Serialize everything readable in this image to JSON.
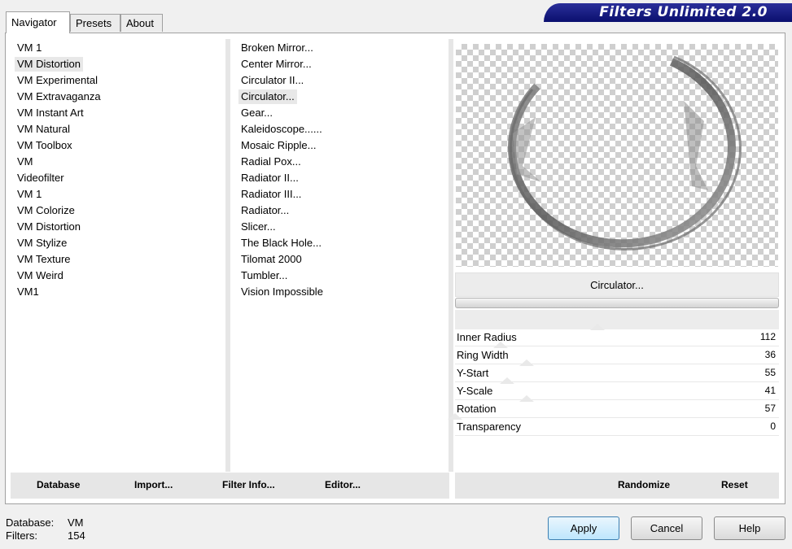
{
  "tabs": [
    {
      "label": "Navigator",
      "active": true
    },
    {
      "label": "Presets",
      "active": false
    },
    {
      "label": "About",
      "active": false
    }
  ],
  "banner": {
    "title": "Filters Unlimited 2.0"
  },
  "categories": [
    {
      "label": "VM 1",
      "selected": false
    },
    {
      "label": "VM Distortion",
      "selected": true
    },
    {
      "label": "VM Experimental",
      "selected": false
    },
    {
      "label": "VM Extravaganza",
      "selected": false
    },
    {
      "label": "VM Instant Art",
      "selected": false
    },
    {
      "label": "VM Natural",
      "selected": false
    },
    {
      "label": "VM Toolbox",
      "selected": false
    },
    {
      "label": "VM",
      "selected": false
    },
    {
      "label": "Videofilter",
      "selected": false
    },
    {
      "label": "VM 1",
      "selected": false
    },
    {
      "label": "VM Colorize",
      "selected": false
    },
    {
      "label": "VM Distortion",
      "selected": false
    },
    {
      "label": "VM Stylize",
      "selected": false
    },
    {
      "label": "VM Texture",
      "selected": false
    },
    {
      "label": "VM Weird",
      "selected": false
    },
    {
      "label": "VM1",
      "selected": false
    }
  ],
  "filters": [
    {
      "label": "Broken Mirror...",
      "selected": false
    },
    {
      "label": "Center Mirror...",
      "selected": false
    },
    {
      "label": "Circulator II...",
      "selected": false
    },
    {
      "label": "Circulator...",
      "selected": true
    },
    {
      "label": "Gear...",
      "selected": false
    },
    {
      "label": "Kaleidoscope......",
      "selected": false
    },
    {
      "label": "Mosaic Ripple...",
      "selected": false
    },
    {
      "label": "Radial Pox...",
      "selected": false
    },
    {
      "label": "Radiator II...",
      "selected": false
    },
    {
      "label": "Radiator III...",
      "selected": false
    },
    {
      "label": "Radiator...",
      "selected": false
    },
    {
      "label": "Slicer...",
      "selected": false
    },
    {
      "label": "The Black Hole...",
      "selected": false
    },
    {
      "label": "Tilomat 2000",
      "selected": false
    },
    {
      "label": "Tumbler...",
      "selected": false
    },
    {
      "label": "Vision Impossible",
      "selected": false
    }
  ],
  "preview": {
    "filter_name": "Circulator..."
  },
  "sliders": [
    {
      "label": "Inner Radius",
      "value": "112",
      "fraction": 0.44
    },
    {
      "label": "Ring Width",
      "value": "36",
      "fraction": 0.14
    },
    {
      "label": "Y-Start",
      "value": "55",
      "fraction": 0.22
    },
    {
      "label": "Y-Scale",
      "value": "41",
      "fraction": 0.16
    },
    {
      "label": "Rotation",
      "value": "57",
      "fraction": 0.22
    },
    {
      "label": "Transparency",
      "value": "0",
      "fraction": 0.0
    }
  ],
  "left_buttons": {
    "database": "Database",
    "import": "Import...",
    "filter_info": "Filter Info...",
    "editor": "Editor..."
  },
  "right_buttons": {
    "randomize": "Randomize",
    "reset": "Reset"
  },
  "footer": {
    "database_label": "Database:",
    "database_value": "VM",
    "filters_label": "Filters:",
    "filters_value": "154"
  },
  "dialog_buttons": {
    "apply": "Apply",
    "cancel": "Cancel",
    "help": "Help"
  },
  "colors": {
    "banner": "#0a0f6e",
    "apply_border": "#3c7fb1"
  }
}
